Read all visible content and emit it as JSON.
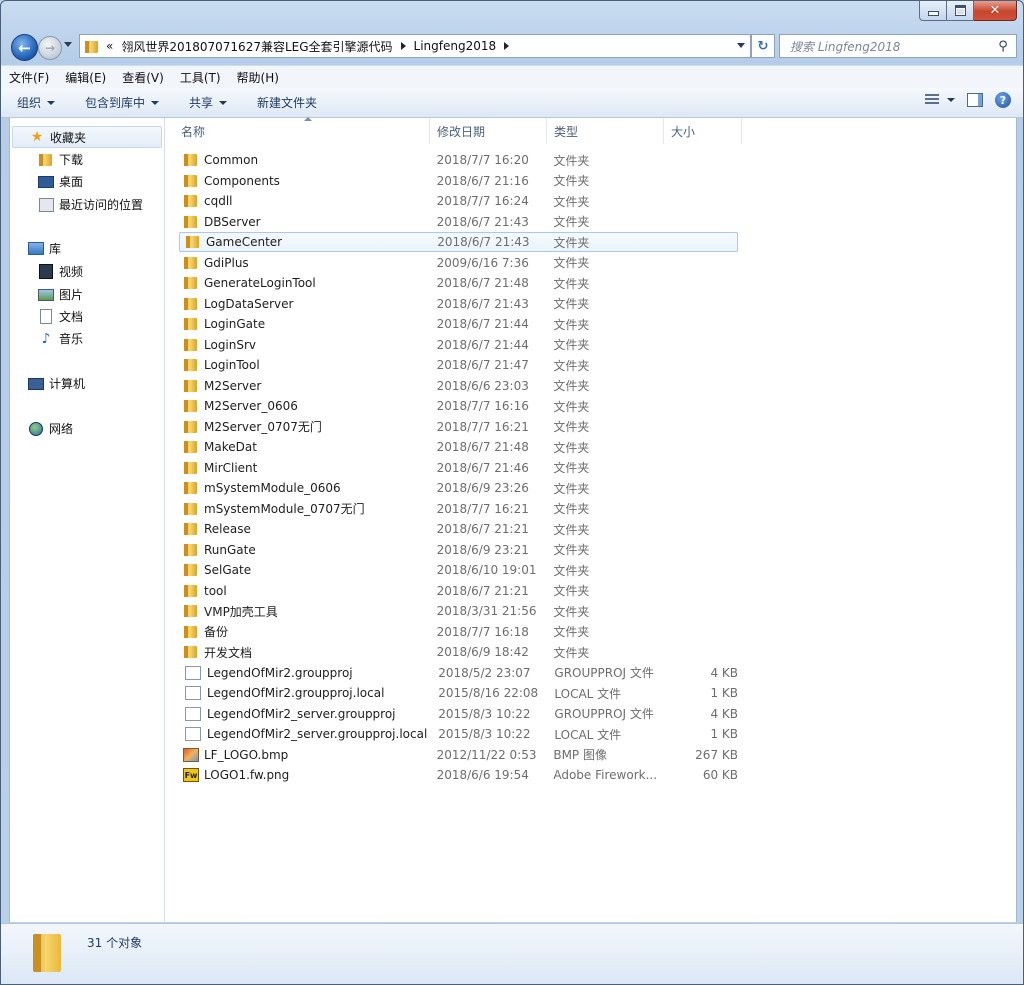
{
  "window": {
    "caption": {
      "minimize": "",
      "maximize": "",
      "close": "✕"
    }
  },
  "nav": {
    "back_glyph": "←",
    "forward_glyph": "→",
    "breadcrumb": [
      "«",
      "翎风世界201807071627兼容LEG全套引擎源代码",
      "Lingfeng2018"
    ],
    "refresh_glyph": "↻",
    "search_placeholder": "搜索 Lingfeng2018",
    "search_icon": "⚲"
  },
  "menu": [
    "文件(F)",
    "编辑(E)",
    "查看(V)",
    "工具(T)",
    "帮助(H)"
  ],
  "toolbar": {
    "organize": "组织",
    "include_in_library": "包含到库中",
    "share": "共享",
    "new_folder": "新建文件夹",
    "help": "?"
  },
  "navpane": {
    "favorites": "收藏夹",
    "downloads": "下载",
    "desktop": "桌面",
    "recent": "最近访问的位置",
    "libraries": "库",
    "videos": "视频",
    "pictures": "图片",
    "documents": "文档",
    "music": "音乐",
    "computer": "计算机",
    "network": "网络"
  },
  "columns": {
    "name": "名称",
    "date": "修改日期",
    "type": "类型",
    "size": "大小"
  },
  "files": [
    {
      "name": "Common",
      "date": "2018/7/7 16:20",
      "type": "文件夹",
      "size": "",
      "icon": "folder"
    },
    {
      "name": "Components",
      "date": "2018/6/7 21:16",
      "type": "文件夹",
      "size": "",
      "icon": "folder"
    },
    {
      "name": "cqdll",
      "date": "2018/7/7 16:24",
      "type": "文件夹",
      "size": "",
      "icon": "folder"
    },
    {
      "name": "DBServer",
      "date": "2018/6/7 21:43",
      "type": "文件夹",
      "size": "",
      "icon": "folder"
    },
    {
      "name": "GameCenter",
      "date": "2018/6/7 21:43",
      "type": "文件夹",
      "size": "",
      "icon": "folder",
      "selected": true
    },
    {
      "name": "GdiPlus",
      "date": "2009/6/16 7:36",
      "type": "文件夹",
      "size": "",
      "icon": "folder"
    },
    {
      "name": "GenerateLoginTool",
      "date": "2018/6/7 21:48",
      "type": "文件夹",
      "size": "",
      "icon": "folder"
    },
    {
      "name": "LogDataServer",
      "date": "2018/6/7 21:43",
      "type": "文件夹",
      "size": "",
      "icon": "folder"
    },
    {
      "name": "LoginGate",
      "date": "2018/6/7 21:44",
      "type": "文件夹",
      "size": "",
      "icon": "folder"
    },
    {
      "name": "LoginSrv",
      "date": "2018/6/7 21:44",
      "type": "文件夹",
      "size": "",
      "icon": "folder"
    },
    {
      "name": "LoginTool",
      "date": "2018/6/7 21:47",
      "type": "文件夹",
      "size": "",
      "icon": "folder"
    },
    {
      "name": "M2Server",
      "date": "2018/6/6 23:03",
      "type": "文件夹",
      "size": "",
      "icon": "folder"
    },
    {
      "name": "M2Server_0606",
      "date": "2018/7/7 16:16",
      "type": "文件夹",
      "size": "",
      "icon": "folder"
    },
    {
      "name": "M2Server_0707无门",
      "date": "2018/7/7 16:21",
      "type": "文件夹",
      "size": "",
      "icon": "folder"
    },
    {
      "name": "MakeDat",
      "date": "2018/6/7 21:48",
      "type": "文件夹",
      "size": "",
      "icon": "folder"
    },
    {
      "name": "MirClient",
      "date": "2018/6/7 21:46",
      "type": "文件夹",
      "size": "",
      "icon": "folder"
    },
    {
      "name": "mSystemModule_0606",
      "date": "2018/6/9 23:26",
      "type": "文件夹",
      "size": "",
      "icon": "folder"
    },
    {
      "name": "mSystemModule_0707无门",
      "date": "2018/7/7 16:21",
      "type": "文件夹",
      "size": "",
      "icon": "folder"
    },
    {
      "name": "Release",
      "date": "2018/6/7 21:21",
      "type": "文件夹",
      "size": "",
      "icon": "folder"
    },
    {
      "name": "RunGate",
      "date": "2018/6/9 23:21",
      "type": "文件夹",
      "size": "",
      "icon": "folder"
    },
    {
      "name": "SelGate",
      "date": "2018/6/10 19:01",
      "type": "文件夹",
      "size": "",
      "icon": "folder"
    },
    {
      "name": "tool",
      "date": "2018/6/7 21:21",
      "type": "文件夹",
      "size": "",
      "icon": "folder"
    },
    {
      "name": "VMP加壳工具",
      "date": "2018/3/31 21:56",
      "type": "文件夹",
      "size": "",
      "icon": "folder"
    },
    {
      "name": "备份",
      "date": "2018/7/7 16:18",
      "type": "文件夹",
      "size": "",
      "icon": "folder"
    },
    {
      "name": "开发文档",
      "date": "2018/6/9 18:42",
      "type": "文件夹",
      "size": "",
      "icon": "folder"
    },
    {
      "name": "LegendOfMir2.groupproj",
      "date": "2018/5/2 23:07",
      "type": "GROUPPROJ 文件",
      "size": "4 KB",
      "icon": "document"
    },
    {
      "name": "LegendOfMir2.groupproj.local",
      "date": "2015/8/16 22:08",
      "type": "LOCAL 文件",
      "size": "1 KB",
      "icon": "document"
    },
    {
      "name": "LegendOfMir2_server.groupproj",
      "date": "2015/8/3 10:22",
      "type": "GROUPPROJ 文件",
      "size": "4 KB",
      "icon": "document"
    },
    {
      "name": "LegendOfMir2_server.groupproj.local",
      "date": "2015/8/3 10:22",
      "type": "LOCAL 文件",
      "size": "1 KB",
      "icon": "document"
    },
    {
      "name": "LF_LOGO.bmp",
      "date": "2012/11/22 0:53",
      "type": "BMP 图像",
      "size": "267 KB",
      "icon": "bmp"
    },
    {
      "name": "LOGO1.fw.png",
      "date": "2018/6/6 19:54",
      "type": "Adobe Firework...",
      "size": "60 KB",
      "icon": "fireworks",
      "icon_text": "Fw"
    }
  ],
  "status": {
    "count": "31 个对象"
  }
}
